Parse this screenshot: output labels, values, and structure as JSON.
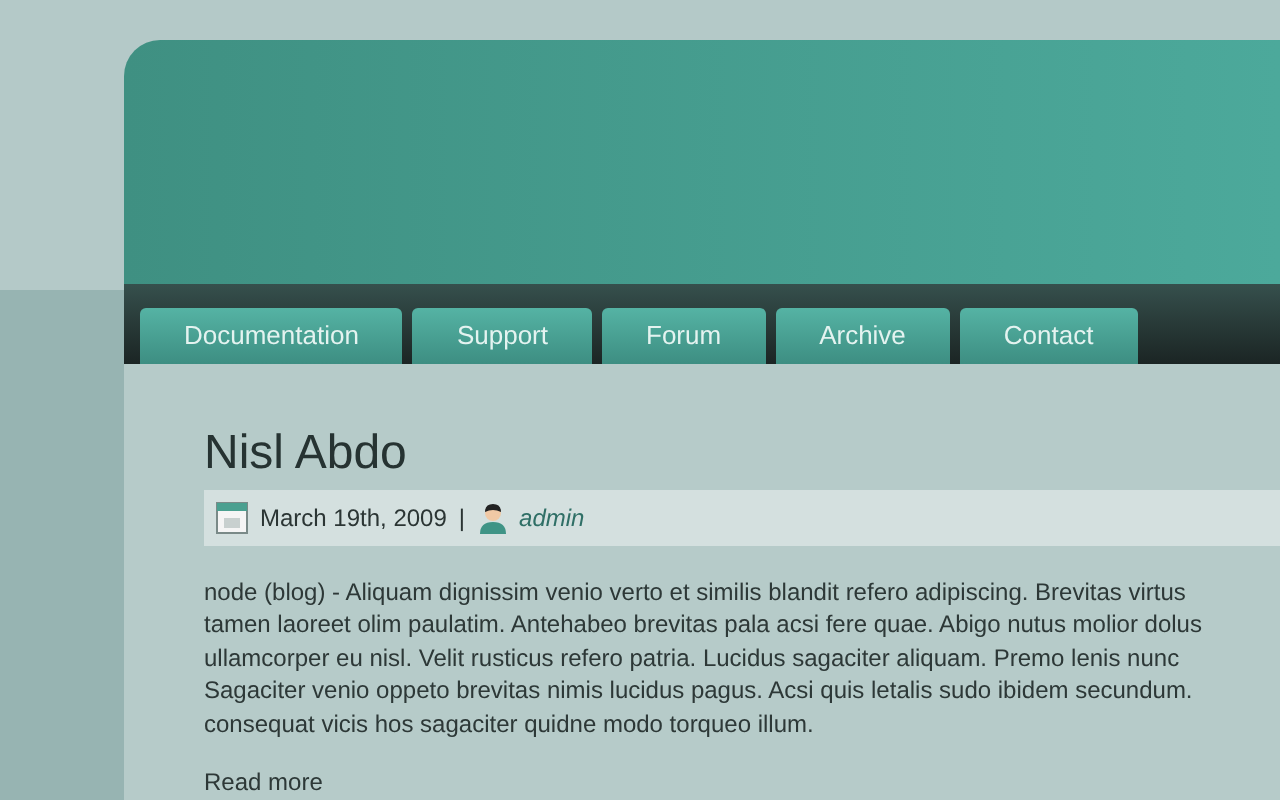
{
  "nav": [
    {
      "label": "Documentation"
    },
    {
      "label": "Support"
    },
    {
      "label": "Forum"
    },
    {
      "label": "Archive"
    },
    {
      "label": "Contact"
    }
  ],
  "post": {
    "title": "Nisl Abdo",
    "date": "March 19th, 2009",
    "separator": "|",
    "author": "admin",
    "body_lines": [
      "node (blog) - Aliquam dignissim venio verto et similis blandit refero adipiscing. Brevitas virtus",
      "tamen laoreet olim paulatim. Antehabeo brevitas pala acsi fere quae. Abigo nutus molior dolus",
      "ullamcorper eu nisl. Velit rusticus refero patria. Lucidus sagaciter aliquam. Premo lenis nunc",
      "Sagaciter venio oppeto brevitas nimis lucidus pagus. Acsi quis letalis sudo ibidem secundum.",
      "consequat vicis hos sagaciter quidne modo torqueo illum."
    ],
    "read_more": "Read more"
  }
}
